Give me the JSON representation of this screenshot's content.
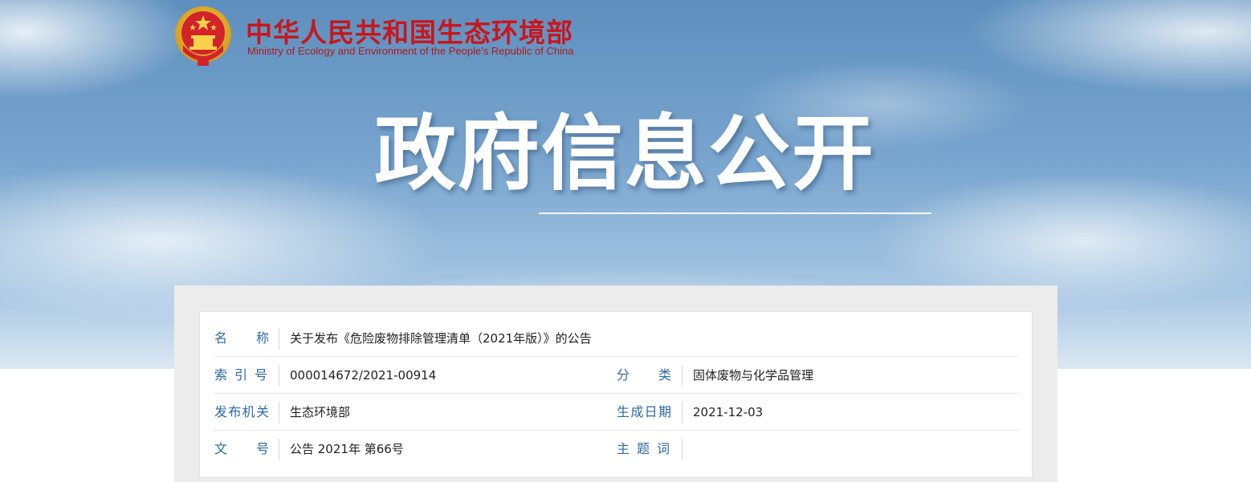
{
  "header": {
    "ministry_cn": "中华人民共和国生态环境部",
    "ministry_en": "Ministry of Ecology and Environment of the People's Republic of China",
    "emblem_icon": "national-emblem-icon",
    "headline": "政府信息公开"
  },
  "colors": {
    "brand_red": "#c8161d",
    "label_blue": "#2c6aa8",
    "sky_blue": "#6e9dca"
  },
  "info": {
    "name_label": "名　　称",
    "name_value": "关于发布《危险废物排除管理清单（2021年版）》的公告",
    "index_label": "索 引 号",
    "index_value": "000014672/2021-00914",
    "category_label": "分　　类",
    "category_value": "固体废物与化学品管理",
    "issuer_label": "发布机关",
    "issuer_value": "生态环境部",
    "date_label": "生成日期",
    "date_value": "2021-12-03",
    "docno_label": "文　　号",
    "docno_value": "公告 2021年 第66号",
    "subject_label": "主 题 词",
    "subject_value": ""
  }
}
